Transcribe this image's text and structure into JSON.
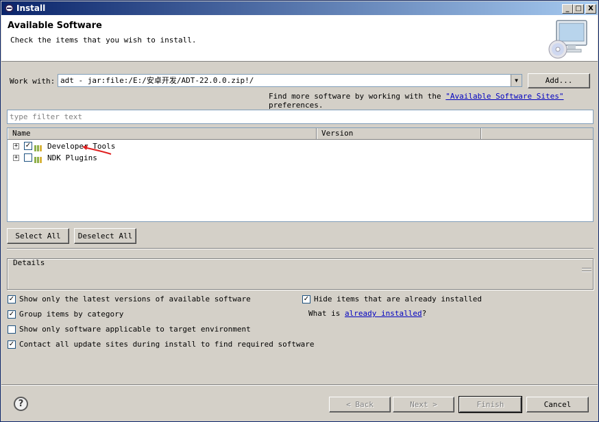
{
  "window": {
    "title": "Install"
  },
  "titlebar_buttons": [
    "_",
    "□",
    "X"
  ],
  "header": {
    "title": "Available Software",
    "subtitle": "Check the items that you wish to install."
  },
  "work_with": {
    "label": "Work with:",
    "value": "adt - jar:file:/E:/安卓开发/ADT-22.0.0.zip!/",
    "add_button": "Add..."
  },
  "sites_note": {
    "prefix": "Find more software by working with the",
    "link": "\"Available Software Sites\"",
    "suffix": "preferences."
  },
  "filter": {
    "placeholder": "type filter text"
  },
  "tree": {
    "columns": [
      "Name",
      "Version",
      ""
    ],
    "items": [
      {
        "label": "Developer Tools",
        "checked": true,
        "expand_symbol": "+"
      },
      {
        "label": "NDK Plugins",
        "checked": false,
        "expand_symbol": "+"
      }
    ]
  },
  "selection_buttons": {
    "select_all": "Select All",
    "deselect_all": "Deselect All"
  },
  "details": {
    "label": "Details"
  },
  "options": [
    {
      "label": "Show only the latest versions of available software",
      "checked": true
    },
    {
      "label": "Group items by category",
      "checked": true
    },
    {
      "label": "Show only software applicable to target environment",
      "checked": false
    },
    {
      "label": "Contact all update sites during install to find required software",
      "checked": true
    }
  ],
  "right_options": {
    "hide_installed": {
      "label": "Hide items that are already installed",
      "checked": true
    },
    "what_is_prefix": "What is",
    "what_is_link": "already installed",
    "what_is_suffix": "?"
  },
  "footer": {
    "help_symbol": "?",
    "back": "< Back",
    "next": "Next >",
    "finish": "Finish",
    "cancel": "Cancel"
  },
  "colors": {
    "titlebar_start": "#0a246a",
    "titlebar_end": "#a6caf0",
    "link": "#0000c0",
    "annotation_arrow": "#e02020"
  }
}
